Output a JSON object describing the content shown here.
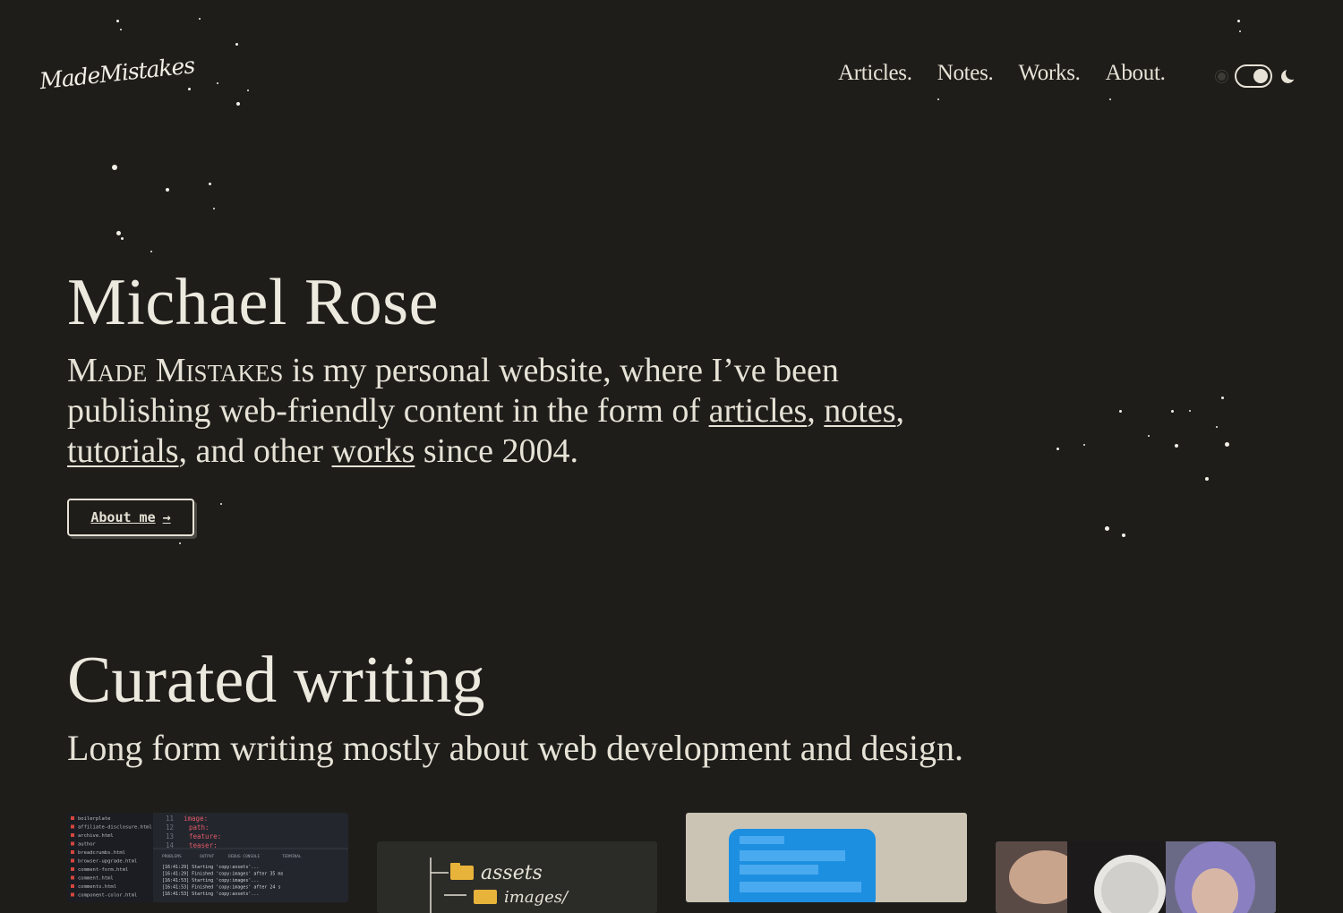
{
  "header": {
    "logo_text": "MadeMistakes",
    "nav": [
      "Articles.",
      "Notes.",
      "Works.",
      "About."
    ],
    "theme_toggle": {
      "state": "dark"
    }
  },
  "hero": {
    "title": "Michael Rose",
    "intro": {
      "site_name": "Made Mistakes",
      "part1": " is my personal website, where I’ve been publishing web-friendly content in the form of ",
      "link_articles": "articles",
      "sep1": ", ",
      "link_notes": "notes",
      "sep2": ", ",
      "link_tutorials": "tutorials",
      "part2": ", and other ",
      "link_works": "works",
      "part3": " since 2004."
    },
    "button_label": "About me",
    "button_arrow": "→"
  },
  "curated": {
    "title": "Curated writing",
    "subtitle": "Long form writing mostly about web development and design."
  },
  "cards": {
    "card1": {
      "files": [
        "boilerplate",
        "affiliate-disclosure.html",
        "archive.html",
        "author",
        "breadcrumbs.html",
        "browser-upgrade.html",
        "comment-form.html",
        "comment.html",
        "comments.html",
        "component-color.html"
      ],
      "code_lines": [
        "image:",
        "path:",
        "feature:",
        "teaser:"
      ],
      "line_numbers": [
        "11",
        "12",
        "13",
        "14"
      ],
      "panel_tabs": [
        "PROBLEMS",
        "OUTPUT",
        "DEBUG CONSOLE",
        "TERMINAL"
      ],
      "terminal": [
        "[16:41:29] Starting 'copy:assets'...",
        "[16:41:29] Finished 'copy:images' after 35 ms",
        "[16:41:53] Starting 'copy:images'...",
        "[16:41:53] Finished 'copy:images' after 24 s",
        "[16:41:53] Starting 'copy:assets'..."
      ]
    },
    "card2": {
      "folders": [
        "assets",
        "images/"
      ]
    }
  }
}
